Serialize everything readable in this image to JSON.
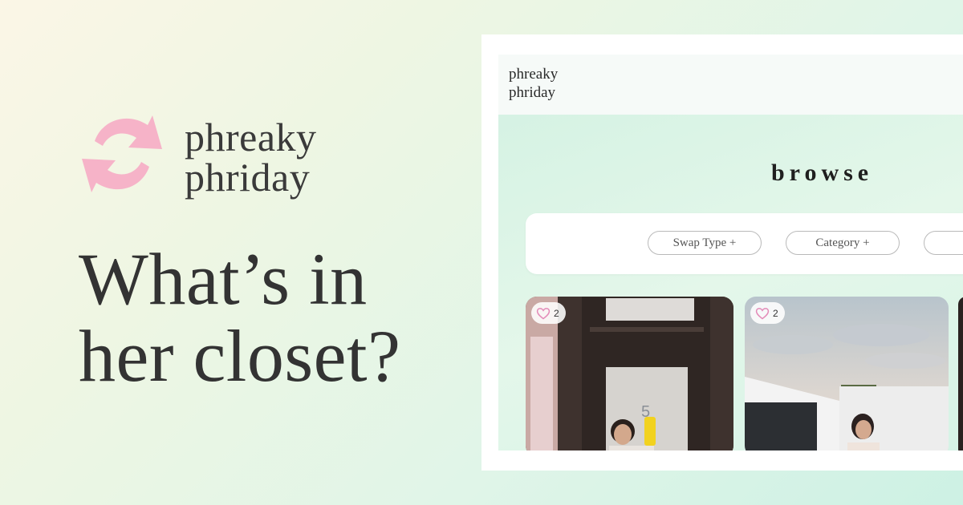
{
  "brand": {
    "line1": "phreaky",
    "line2": "phriday",
    "logo_icon": "swap-arrows-icon",
    "logo_color": "#f6b3c8"
  },
  "headline": {
    "line1": "What’s in",
    "line2": "her closet?"
  },
  "mock": {
    "brand": {
      "line1": "phreaky",
      "line2": "phriday"
    },
    "page_title": "browse",
    "filters": [
      {
        "label": "Swap Type +"
      },
      {
        "label": "Category +"
      },
      {
        "label": ""
      }
    ],
    "cards": [
      {
        "likes": "2",
        "heart_icon": "heart-outline-icon"
      },
      {
        "likes": "2",
        "heart_icon": "heart-outline-icon"
      }
    ],
    "colors": {
      "heart": "#e38bb8",
      "background": "#d2f1e2"
    }
  }
}
